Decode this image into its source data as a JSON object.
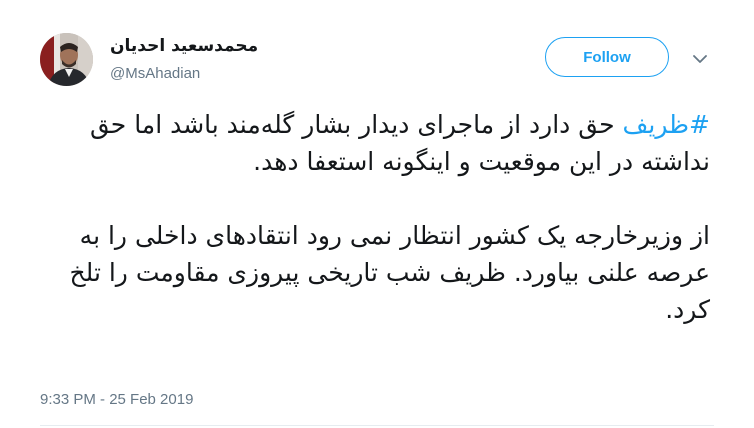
{
  "author": {
    "name": "محمدسعید احدیان",
    "handle": "@MsAhadian"
  },
  "follow_label": "Follow",
  "tweet": {
    "hashtag": "#ظریف",
    "line1_rest": " حق دارد از ماجرای دیدار بشار گله‌مند باشد اما حق نداشته در این موقعیت و اینگونه استعفا دهد.",
    "paragraph2": "از وزیرخارجه یک کشور انتظار نمی رود انتقادهای داخلی را به عرصه علنی بیاورد. ظریف شب تاریخی پیروزی مقاومت را تلخ کرد."
  },
  "timestamp": "9:33 PM - 25 Feb 2019",
  "colors": {
    "accent": "#1da1f2",
    "text": "#14171a",
    "secondary": "#657786"
  },
  "icons": {
    "menu": "chevron-down-icon"
  }
}
